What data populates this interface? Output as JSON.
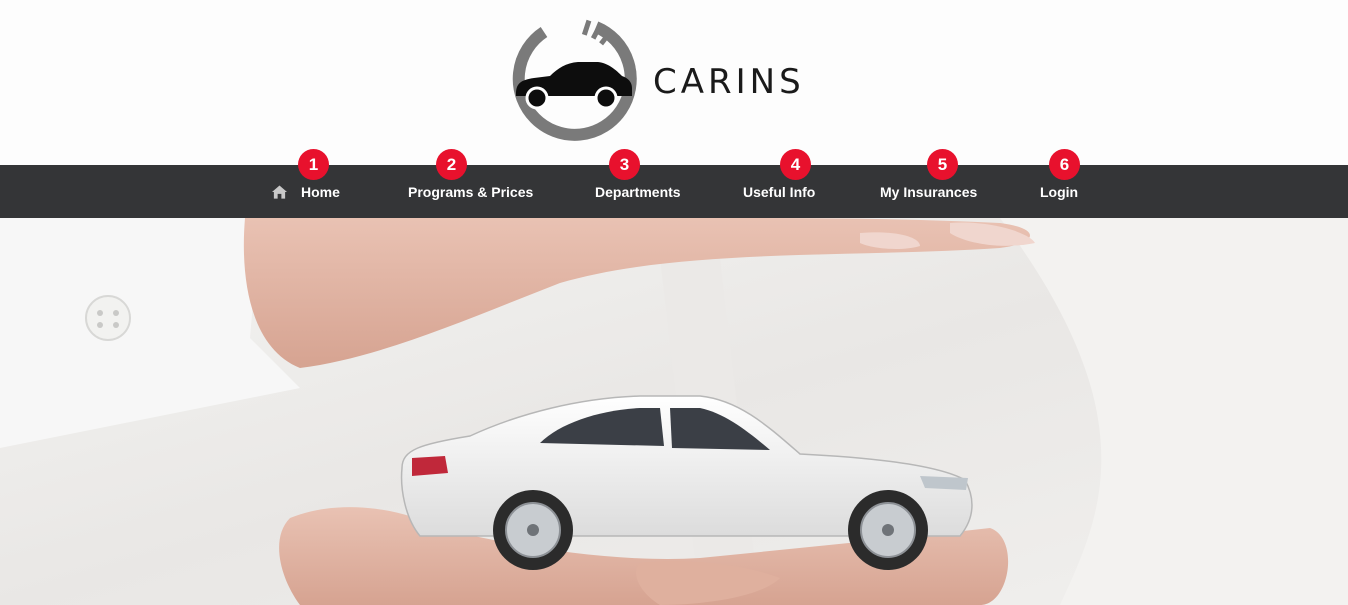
{
  "brand": {
    "name": "CARINS",
    "logo_icon": "car-gauge-logo"
  },
  "nav": {
    "home_icon": "home-icon",
    "items": [
      {
        "label": "Home",
        "badge": "1"
      },
      {
        "label": "Programs & Prices",
        "badge": "2"
      },
      {
        "label": "Departments",
        "badge": "3"
      },
      {
        "label": "Useful Info",
        "badge": "4"
      },
      {
        "label": "My Insurances",
        "badge": "5"
      },
      {
        "label": "Login",
        "badge": "6"
      }
    ]
  },
  "colors": {
    "navbar_bg": "#343537",
    "badge_bg": "#e8112d",
    "nav_text": "#ffffff",
    "logo_ring": "#7a7a7a",
    "header_bg": "#fdfdfd"
  },
  "hero": {
    "image": "hands-protecting-model-car"
  }
}
